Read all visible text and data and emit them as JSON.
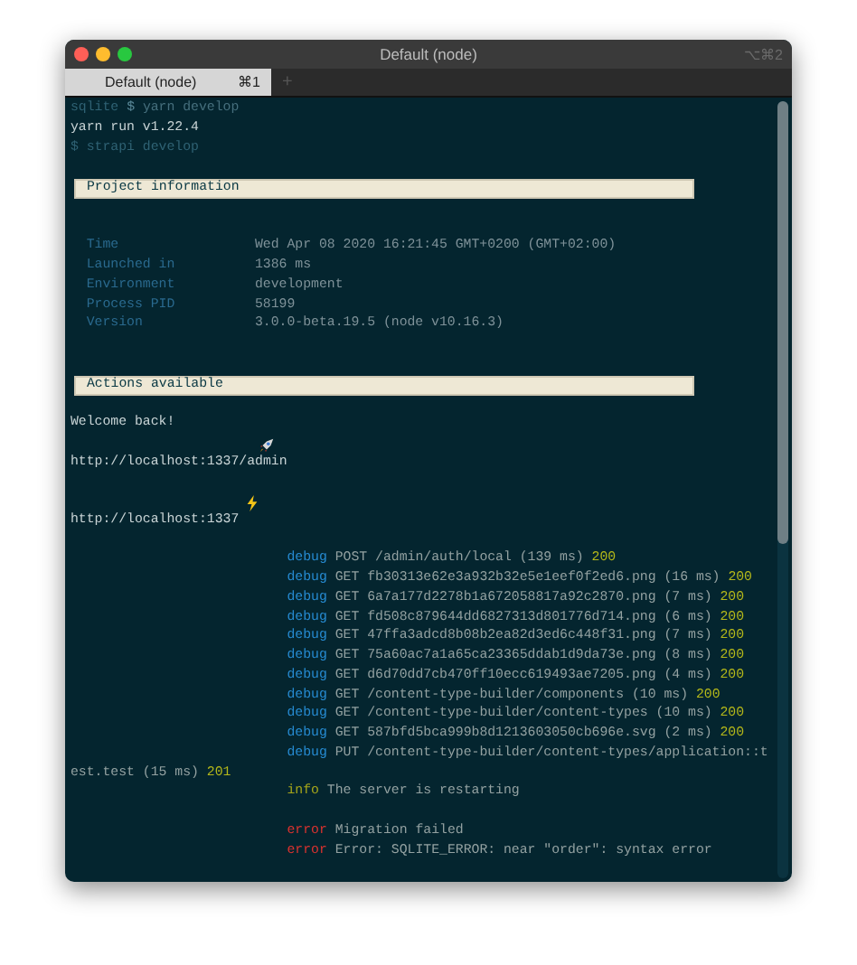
{
  "window": {
    "title": "Default (node)",
    "shortcut": "⌥⌘2"
  },
  "tabs": [
    {
      "label": "Default (node)",
      "shortcut": "⌘1",
      "selected": true
    }
  ],
  "new_tab": "+",
  "terminal": {
    "lines": [
      {
        "kind": "prompt",
        "host": "sqlite",
        "sign": "$",
        "command": "yarn develop"
      },
      {
        "kind": "output",
        "text": "yarn run v1.22.4"
      },
      {
        "kind": "echo",
        "text": "$ strapi develop"
      },
      {
        "kind": "blank"
      },
      {
        "kind": "banner",
        "text": "Project information"
      },
      {
        "kind": "blank"
      },
      {
        "kind": "blank"
      },
      {
        "kind": "field",
        "key": "Time",
        "value": "Wed Apr 08 2020 16:21:45 GMT+0200 (GMT+02:00)"
      },
      {
        "kind": "field",
        "key": "Launched in",
        "value": "1386 ms"
      },
      {
        "kind": "field",
        "key": "Environment",
        "value": "development"
      },
      {
        "kind": "field",
        "key": "Process PID",
        "value": "58199"
      },
      {
        "kind": "field",
        "key": "Version",
        "value": "3.0.0-beta.19.5 (node v10.16.3)"
      },
      {
        "kind": "blank"
      },
      {
        "kind": "blank"
      },
      {
        "kind": "banner",
        "text": "Actions available"
      },
      {
        "kind": "blank"
      },
      {
        "kind": "output",
        "text": "Welcome back!"
      },
      {
        "kind": "admin_url",
        "text": "http://localhost:1337/admin"
      },
      {
        "kind": "blank"
      },
      {
        "kind": "app_url",
        "text": "http://localhost:1337"
      },
      {
        "kind": "blank"
      },
      {
        "kind": "debug",
        "tag": "debug",
        "message": "POST /admin/auth/local (139 ms)",
        "status": "200"
      },
      {
        "kind": "debug",
        "tag": "debug",
        "message": "GET fb30313e62e3a932b32e5e1eef0f2ed6.png (16 ms)",
        "status": "200"
      },
      {
        "kind": "debug",
        "tag": "debug",
        "message": "GET 6a7a177d2278b1a672058817a92c2870.png (7 ms)",
        "status": "200"
      },
      {
        "kind": "debug",
        "tag": "debug",
        "message": "GET fd508c879644dd6827313d801776d714.png (6 ms)",
        "status": "200"
      },
      {
        "kind": "debug",
        "tag": "debug",
        "message": "GET 47ffa3adcd8b08b2ea82d3ed6c448f31.png (7 ms)",
        "status": "200"
      },
      {
        "kind": "debug",
        "tag": "debug",
        "message": "GET 75a60ac7a1a65ca23365ddab1d9da73e.png (8 ms)",
        "status": "200"
      },
      {
        "kind": "debug",
        "tag": "debug",
        "message": "GET d6d70dd7cb470ff10ecc619493ae7205.png (4 ms)",
        "status": "200"
      },
      {
        "kind": "debug",
        "tag": "debug",
        "message": "GET /content-type-builder/components (10 ms)",
        "status": "200"
      },
      {
        "kind": "debug",
        "tag": "debug",
        "message": "GET /content-type-builder/content-types (10 ms)",
        "status": "200"
      },
      {
        "kind": "debug",
        "tag": "debug",
        "message": "GET 587bfd5bca999b8d1213603050cb696e.svg (2 ms)",
        "status": "200"
      },
      {
        "kind": "debug",
        "tag": "debug",
        "message": "PUT /content-type-builder/content-types/application::t"
      },
      {
        "kind": "continuation",
        "message": "est.test (15 ms)",
        "status": "201"
      },
      {
        "kind": "info",
        "tag": "info",
        "message": "The server is restarting"
      },
      {
        "kind": "blank"
      },
      {
        "kind": "error",
        "tag": "error",
        "message": "Migration failed"
      },
      {
        "kind": "error",
        "tag": "error",
        "message": "Error: SQLITE_ERROR: near \"order\": syntax error"
      }
    ]
  }
}
